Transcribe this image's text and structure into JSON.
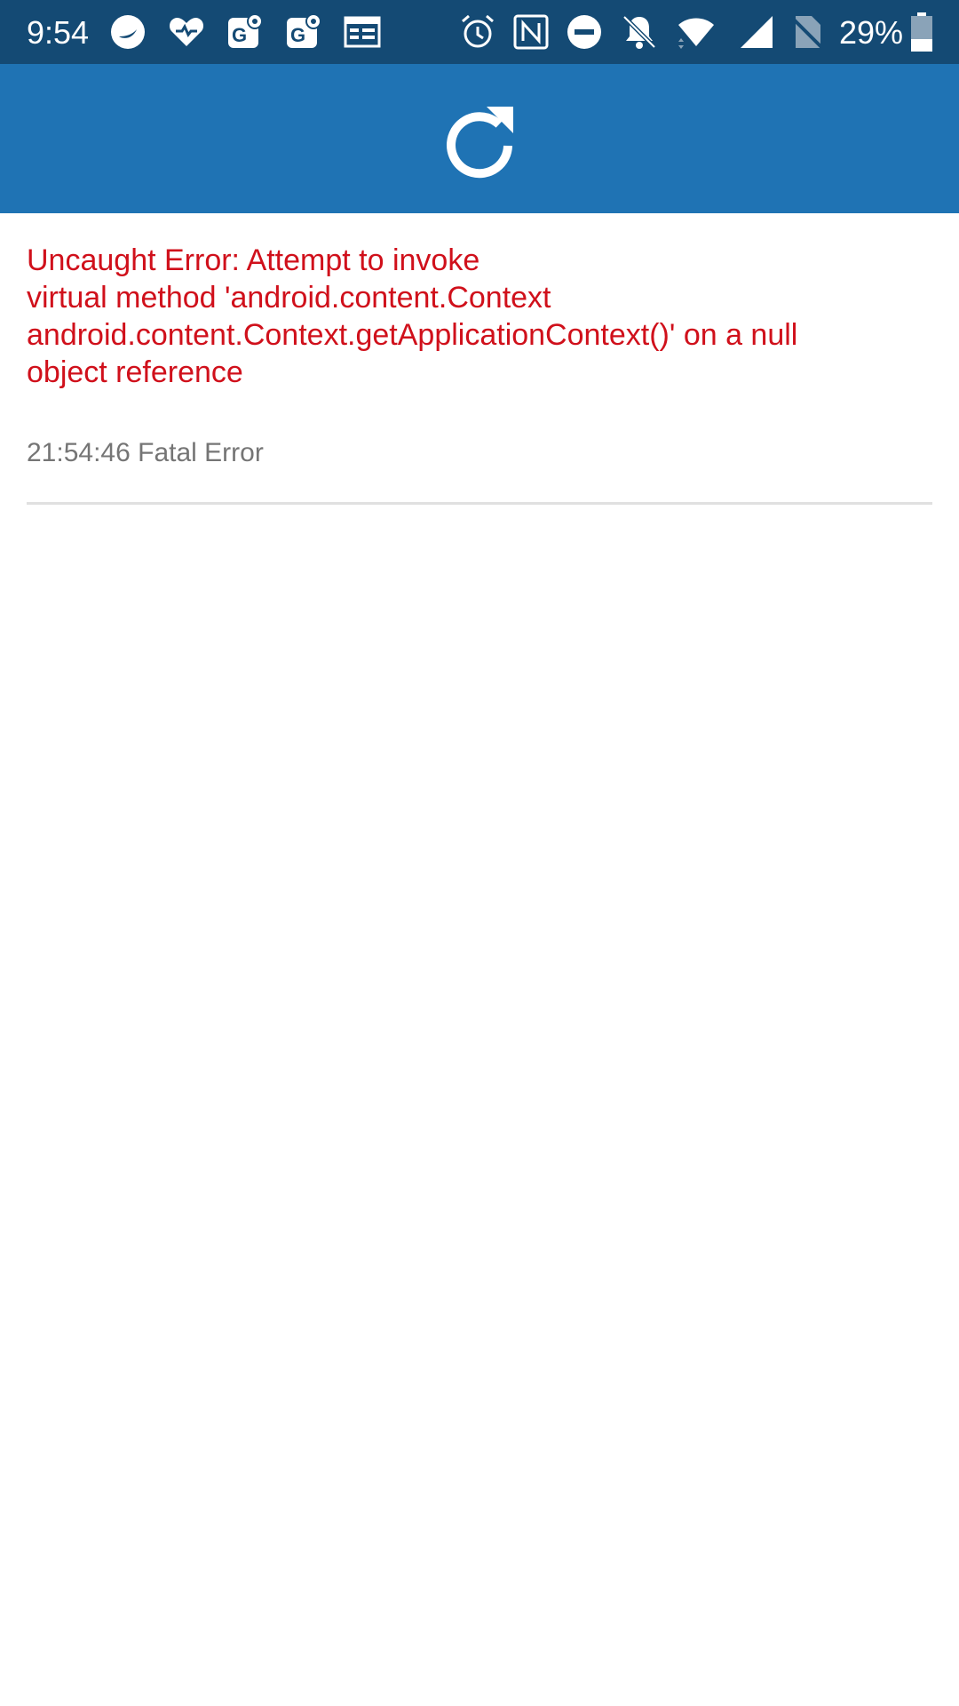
{
  "status_bar": {
    "time": "9:54",
    "battery_percent": "29%",
    "background": "#144a74",
    "left_icons": [
      "app-notification-icon",
      "health-icon",
      "maps-g-icon",
      "maps-g-icon",
      "calendar-icon"
    ],
    "right_icons": [
      "alarm-icon",
      "nfc-icon",
      "do-not-disturb-icon",
      "notifications-off-icon",
      "wifi-icon",
      "cell-signal-icon",
      "no-sim-icon",
      "battery-icon"
    ]
  },
  "toolbar": {
    "background": "#1f73b4",
    "action_icon": "refresh-icon"
  },
  "error_log": {
    "entries": [
      {
        "message_lines": [
          "Uncaught Error: Attempt to invoke",
          "virtual method 'android.content.Context",
          "android.content.Context.getApplicationContext()' on a null",
          "object reference"
        ],
        "meta": "21:54:46 Fatal Error"
      }
    ],
    "message_color": "#d0101b",
    "meta_color": "#757575"
  }
}
